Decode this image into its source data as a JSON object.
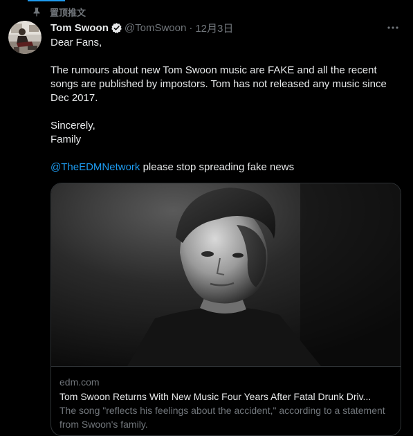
{
  "pinned": {
    "label": "置顶推文",
    "icon": "pin-icon"
  },
  "tweet": {
    "author": {
      "display_name": "Tom Swoon",
      "handle": "@TomSwoon",
      "verified": true,
      "avatar_icon": "avatar"
    },
    "separator": "·",
    "date": "12月3日",
    "more_icon": "more-options-icon",
    "text": {
      "line1": "Dear Fans,",
      "line2": "The rumours about new Tom Swoon music are FAKE and all the recent songs are published by impostors. Tom has not released any music since Dec 2017.",
      "line3": "Sincerely,",
      "line4": "Family",
      "mention": "@TheEDMNetwork",
      "line5_rest": " please stop spreading fake news"
    },
    "card": {
      "domain": "edm.com",
      "title": "Tom Swoon Returns With New Music Four Years After Fatal Drunk Driv...",
      "description": "The song \"reflects his feelings about the accident,\" according to a statement from Swoon's family."
    }
  },
  "colors": {
    "background": "#000000",
    "text": "#e7e9ea",
    "muted": "#71767b",
    "link": "#1d9bf0",
    "border": "#2f3336"
  }
}
